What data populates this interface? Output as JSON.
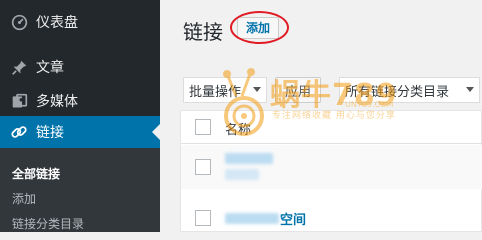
{
  "sidebar": {
    "items": [
      {
        "label": "仪表盘",
        "icon": "dashboard-icon"
      },
      {
        "label": "文章",
        "icon": "pin-icon"
      },
      {
        "label": "多媒体",
        "icon": "media-icon"
      },
      {
        "label": "链接",
        "icon": "link-icon",
        "active": true
      }
    ],
    "submenu": [
      {
        "label": "全部链接",
        "current": true
      },
      {
        "label": "添加"
      },
      {
        "label": "链接分类目录"
      }
    ]
  },
  "main": {
    "title": "链接",
    "add_button": "添加",
    "bulk_select": "批量操作",
    "apply_button": "应用",
    "category_select": "所有链接分类目录",
    "table": {
      "column_name": "名称",
      "rows": [
        {
          "name_visible": ""
        },
        {
          "name_visible": "空间"
        }
      ]
    }
  },
  "watermark": {
    "brand": "蜗牛789",
    "url": "UN789.COM",
    "slogan": "专注网络收藏  用心与您分享"
  },
  "colors": {
    "sidebar_bg": "#23282d",
    "active_bg": "#0073aa",
    "highlight_ring": "#e01b24",
    "link": "#0073aa"
  }
}
